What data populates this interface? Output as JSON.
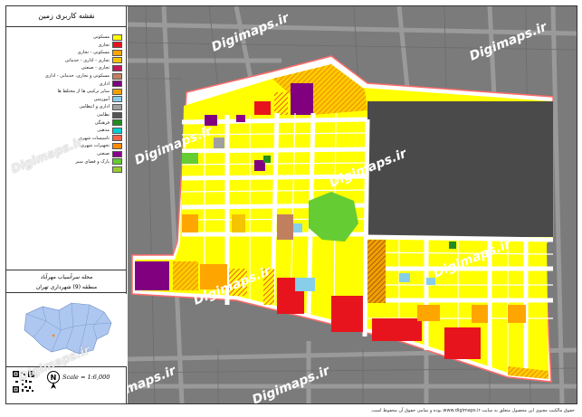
{
  "legend": {
    "title": "نقشه کاربری زمین",
    "items": [
      {
        "label": "مسکونی",
        "color": "#ffff00"
      },
      {
        "label": "تجاری",
        "color": "#e8141d"
      },
      {
        "label": "مسکونی - تجاری",
        "color": "#ffa500"
      },
      {
        "label": "تجاری - اداری - خدماتی",
        "color": "#f5c400"
      },
      {
        "label": "تجاری - صنعتی",
        "color": "#c2185b"
      },
      {
        "label": "مسکونی و تجاری، خدماتی - اداری",
        "color": "#c08060"
      },
      {
        "label": "اداری",
        "color": "#800080"
      },
      {
        "label": "سایر ترکیبی ها از مختلط ها",
        "color": "#f0a000"
      },
      {
        "label": "آموزشی",
        "color": "#87ceeb"
      },
      {
        "label": "اداری و انتظامی",
        "color": "#a0a0a0"
      },
      {
        "label": "نظامی",
        "color": "#555555"
      },
      {
        "label": "فرهنگی",
        "color": "#228b22"
      },
      {
        "label": "مذهبی",
        "color": "#00ced1"
      },
      {
        "label": "تاسیسات شهری",
        "color": "#ff6347"
      },
      {
        "label": "تجهیزات شهری",
        "color": "#ff8c00"
      },
      {
        "label": "صنعتی",
        "color": "#8b008b"
      },
      {
        "label": "پارک و فضای سبز",
        "color": "#66cc33"
      },
      {
        "label": "",
        "color": "#9acd32"
      }
    ]
  },
  "location": {
    "neighborhood": "محله سرآسیاب مهرآباد",
    "district": "منطقه (9) شهرداری تهران"
  },
  "scale": "Scale = 1:6,000",
  "watermark": "Digimaps.ir",
  "footer": "حقوق مالکیت معنوی این محصول متعلق به سایت www.digimaps.ir بوده و تمامی حقوق آن محفوظ است."
}
